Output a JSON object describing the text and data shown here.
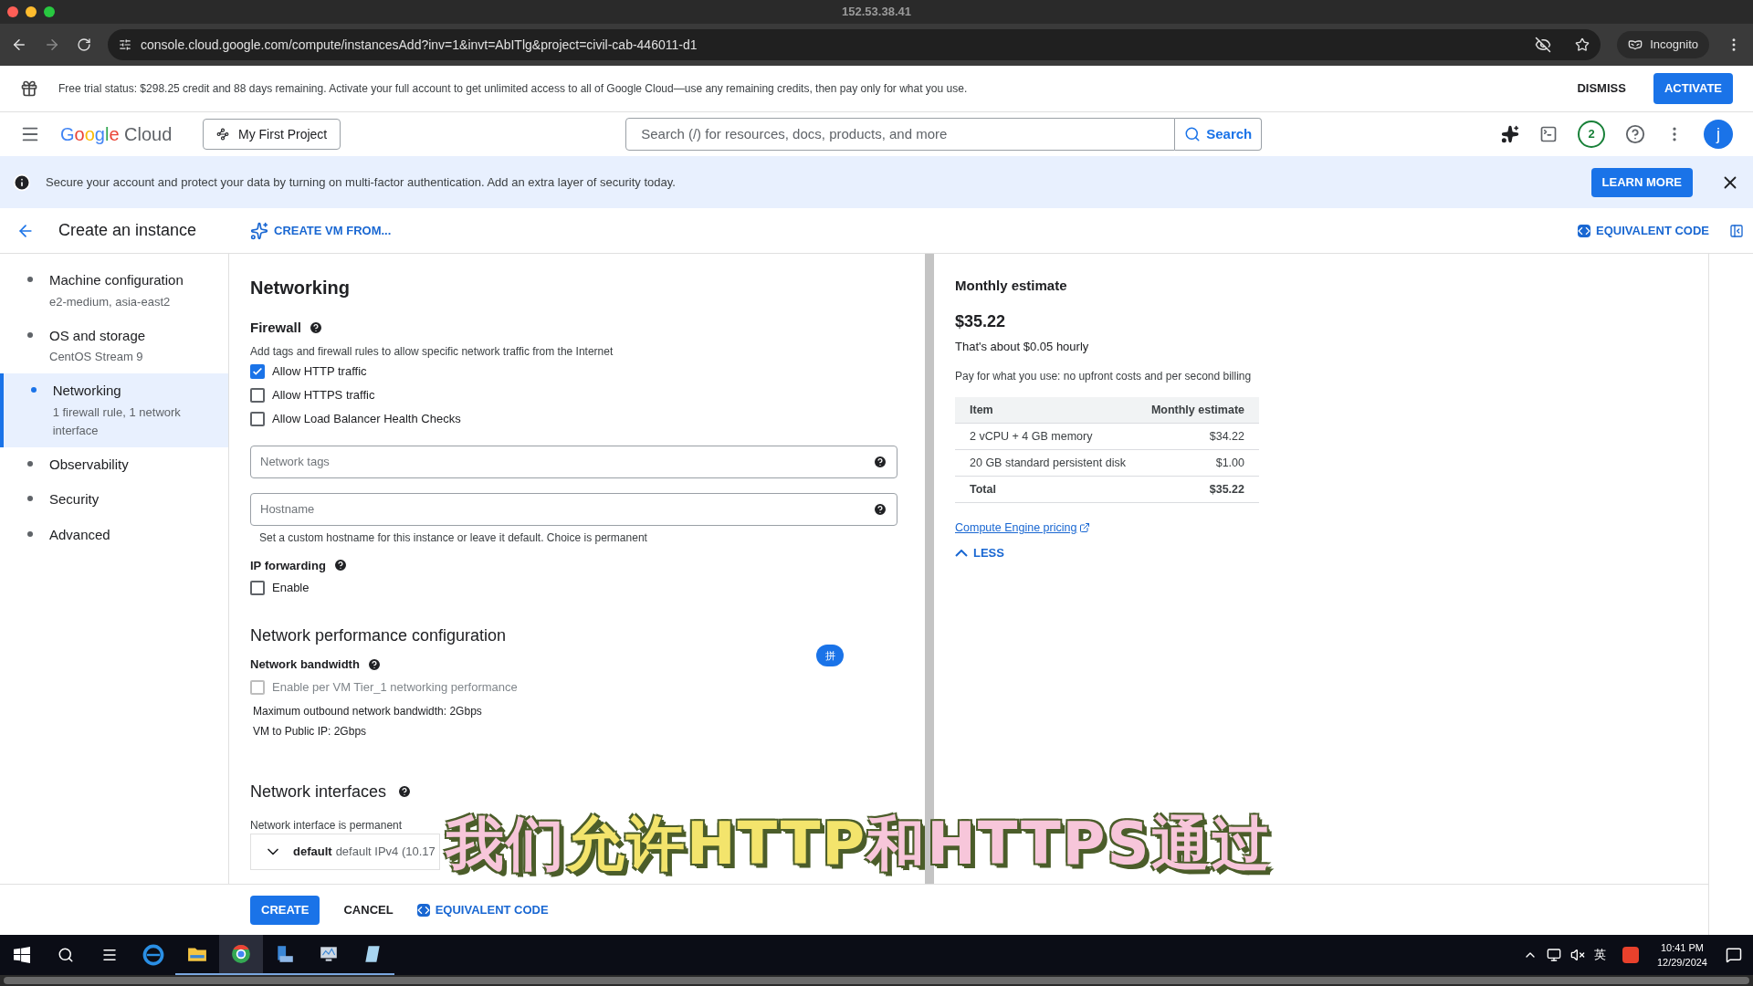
{
  "window": {
    "title": "152.53.38.41"
  },
  "browser": {
    "url": "console.cloud.google.com/compute/instancesAdd?inv=1&invt=AbITlg&project=civil-cab-446011-d1",
    "mode": "Incognito"
  },
  "trial_banner": {
    "text": "Free trial status: $298.25 credit and 88 days remaining. Activate your full account to get unlimited access to all of Google Cloud—use any remaining credits, then pay only for what you use.",
    "dismiss": "DISMISS",
    "activate": "ACTIVATE"
  },
  "header": {
    "logo": "Google",
    "logo_suffix": "Cloud",
    "project": "My First Project",
    "search_placeholder": "Search (/) for resources, docs, products, and more",
    "search_button": "Search",
    "notifications": "2",
    "avatar": "j"
  },
  "mfa_banner": {
    "text": "Secure your account and protect your data by turning on multi-factor authentication. Add an extra layer of security today.",
    "action": "LEARN MORE"
  },
  "page": {
    "title": "Create an instance",
    "create_from": "CREATE VM FROM...",
    "equivalent_code": "EQUIVALENT CODE"
  },
  "sidebar": {
    "items": [
      {
        "label": "Machine configuration",
        "detail": "e2-medium, asia-east2",
        "selected": false
      },
      {
        "label": "OS and storage",
        "detail": "CentOS Stream 9",
        "selected": false
      },
      {
        "label": "Networking",
        "detail": "1 firewall rule, 1 network interface",
        "selected": true
      },
      {
        "label": "Observability",
        "selected": false
      },
      {
        "label": "Security",
        "selected": false
      },
      {
        "label": "Advanced",
        "selected": false
      }
    ]
  },
  "networking": {
    "title": "Networking",
    "firewall": {
      "title": "Firewall",
      "description": "Add tags and firewall rules to allow specific network traffic from the Internet",
      "options": [
        {
          "label": "Allow HTTP traffic",
          "checked": true
        },
        {
          "label": "Allow HTTPS traffic",
          "checked": false
        },
        {
          "label": "Allow Load Balancer Health Checks",
          "checked": false
        }
      ]
    },
    "fields": [
      {
        "placeholder": "Network tags"
      },
      {
        "placeholder": "Hostname",
        "hint": "Set a custom hostname for this instance or leave it default. Choice is permanent"
      }
    ],
    "ip_forwarding": {
      "title": "IP forwarding",
      "option": {
        "label": "Enable",
        "checked": false
      }
    },
    "performance": {
      "title": "Network performance configuration",
      "bandwidth_title": "Network bandwidth",
      "option": {
        "label": "Enable per VM Tier_1 networking performance",
        "checked": false,
        "disabled": true
      },
      "lines": [
        "Maximum outbound network bandwidth: 2Gbps",
        "VM to Public IP: 2Gbps"
      ]
    },
    "interfaces": {
      "title": "Network interfaces",
      "note": "Network interface is permanent",
      "row": {
        "name": "default",
        "detail": "default IPv4 (10.17"
      }
    }
  },
  "ime_badge": "拼",
  "estimate": {
    "title": "Monthly estimate",
    "price": "$35.22",
    "hourly": "That's about $0.05 hourly",
    "note": "Pay for what you use: no upfront costs and per second billing",
    "columns": [
      "Item",
      "Monthly estimate"
    ],
    "rows": [
      {
        "item": "2 vCPU + 4 GB memory",
        "cost": "$34.22",
        "kind": "line"
      },
      {
        "item": "20 GB standard persistent disk",
        "cost": "$1.00",
        "kind": "line"
      },
      {
        "item": "Total",
        "cost": "$35.22",
        "kind": "total"
      }
    ],
    "link": "Compute Engine pricing",
    "toggle": "LESS"
  },
  "actions": {
    "create": "CREATE",
    "cancel": "CANCEL",
    "code": "EQUIVALENT CODE"
  },
  "subtitle": [
    {
      "text": "我们",
      "color": "#f7c6da"
    },
    {
      "text": "允许HTTP",
      "color": "#f3e46c"
    },
    {
      "text": "和HTTPS通过",
      "color": "#f7c6da"
    }
  ],
  "taskbar": {
    "language": "英",
    "time": "10:41 PM",
    "date": "12/29/2024"
  }
}
